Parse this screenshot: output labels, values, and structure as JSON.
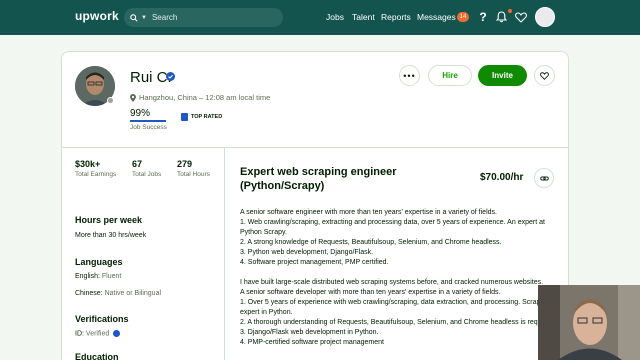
{
  "nav": {
    "logo": "upwork",
    "search_placeholder": "Search",
    "links": [
      "Jobs",
      "Talent",
      "Reports",
      "Messages"
    ],
    "messages_badge": "14",
    "help_label": "?"
  },
  "profile": {
    "name": "Rui C.",
    "location": "Hangzhou, China – 12:08 am local time",
    "job_success": "99%",
    "job_success_label": "Job Success",
    "top_rated": "TOP RATED",
    "hire_label": "Hire",
    "invite_label": "Invite",
    "more_label": "•••"
  },
  "stats": [
    {
      "value": "$30k+",
      "label": "Total Earnings"
    },
    {
      "value": "67",
      "label": "Total Jobs"
    },
    {
      "value": "279",
      "label": "Total Hours"
    }
  ],
  "sidebar": {
    "hours_heading": "Hours per week",
    "hours_value": "More than 30 hrs/week",
    "languages_heading": "Languages",
    "languages": [
      {
        "name": "English:",
        "level": "Fluent"
      },
      {
        "name": "Chinese:",
        "level": "Native or Bilingual"
      }
    ],
    "verifications_heading": "Verifications",
    "id_label": "ID:",
    "id_value": "Verified",
    "education_heading": "Education"
  },
  "main": {
    "title": "Expert web scraping engineer (Python/Scrapy)",
    "rate": "$70.00/hr",
    "paragraph1": [
      "A senior software engineer with more than ten years' expertise in a variety of fields.",
      "1. Web crawling/scraping, extracting and processing data, over 5 years of experience. An expert at Python Scrapy.",
      "2. A strong knowledge of Requests, Beautifulsoup, Selenium, and Chrome headless.",
      "3. Python web development, Django/Flask.",
      "4. Software project management, PMP certified."
    ],
    "paragraph2": [
      "I have built large-scale distributed web scraping systems before, and cracked numerous websites.",
      "A senior software developer with more than ten years' expertise in a variety of fields.",
      "1. Over 5 years of experience with web crawling/scraping, data extraction, and processing. Scrapy expert in Python.",
      "2. A thorough understanding of Requests, Beautifulsoup, Selenium, and Chrome headless is required.",
      "3. Django/Flask web development in Python.",
      "4. PMP-certified software project management"
    ]
  },
  "colors": {
    "nav_bg": "#13544e",
    "brand_green": "#108a00",
    "verified_blue": "#1f57c3",
    "badge_orange": "#f26b2e"
  }
}
